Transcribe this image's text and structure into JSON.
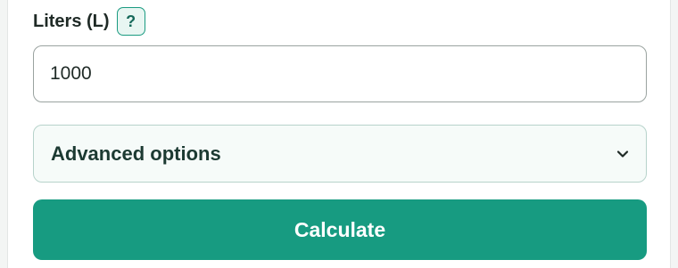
{
  "field": {
    "label": "Liters (L)",
    "help_label": "?",
    "value": "1000"
  },
  "advanced": {
    "label": "Advanced options",
    "icon": "chevron-down-icon"
  },
  "actions": {
    "calculate_label": "Calculate"
  },
  "colors": {
    "accent": "#179b81",
    "help_border": "#1a9b81",
    "help_bg": "#e8f6f2",
    "text_dark": "#1f2a26"
  }
}
